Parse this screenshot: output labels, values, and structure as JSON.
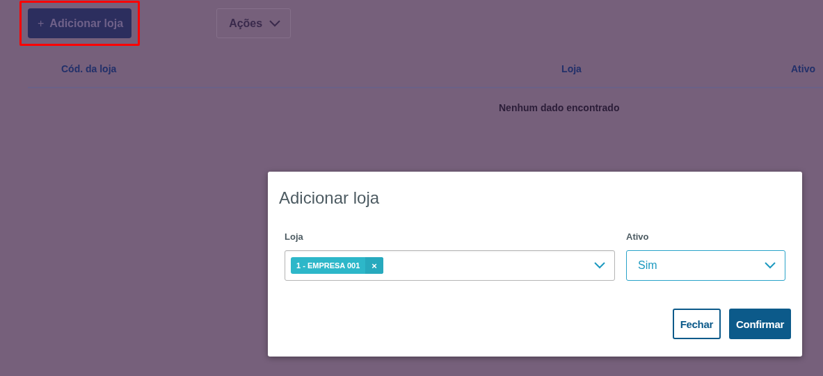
{
  "toolbar": {
    "add_button": {
      "icon": "+",
      "label": "Adicionar loja",
      "highlighted": true
    },
    "actions_button": {
      "label": "Ações"
    }
  },
  "table": {
    "columns": [
      "Cód. da loja",
      "Loja",
      "Ativo"
    ],
    "empty_message": "Nenhum dado encontrado"
  },
  "dialog": {
    "title": "Adicionar loja",
    "fields": [
      {
        "kind": "multiselect",
        "label": "Loja",
        "focused": false,
        "tags": [
          {
            "label": "1 - EMPRESA 001",
            "remove": "×"
          }
        ]
      },
      {
        "kind": "select",
        "label": "Ativo",
        "value": "Sim",
        "focused": true
      }
    ],
    "buttons": [
      {
        "label": "Fechar",
        "kind": "secondary"
      },
      {
        "label": "Confirmar",
        "kind": "primary"
      }
    ]
  }
}
